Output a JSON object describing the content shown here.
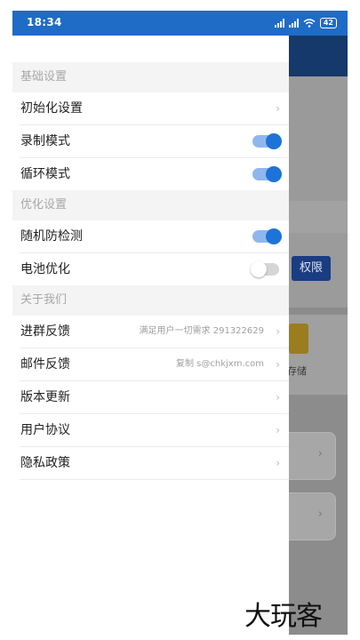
{
  "status_bar": {
    "time": "18:34",
    "battery": "42",
    "icons": [
      "signal-icon",
      "signal-icon",
      "wifi-icon",
      "battery-icon"
    ]
  },
  "background_app": {
    "permission_button": "权限",
    "storage_label": "存储"
  },
  "drawer": {
    "sections": [
      {
        "title": "基础设置",
        "items": [
          {
            "label": "初始化设置",
            "type": "chevron"
          },
          {
            "label": "录制模式",
            "type": "toggle",
            "on": true
          },
          {
            "label": "循环模式",
            "type": "toggle",
            "on": true
          }
        ]
      },
      {
        "title": "优化设置",
        "items": [
          {
            "label": "随机防检测",
            "type": "toggle",
            "on": true
          },
          {
            "label": "电池优化",
            "type": "toggle",
            "on": false
          }
        ]
      },
      {
        "title": "关于我们",
        "items": [
          {
            "label": "进群反馈",
            "sub": "满足用户一切需求 291322629",
            "type": "chevron"
          },
          {
            "label": "邮件反馈",
            "sub": "复制 s@chkjxm.com",
            "type": "chevron"
          },
          {
            "label": "版本更新",
            "type": "chevron"
          },
          {
            "label": "用户协议",
            "type": "chevron"
          },
          {
            "label": "隐私政策",
            "type": "chevron"
          }
        ]
      }
    ]
  },
  "watermark": "大玩客",
  "colors": {
    "status_bar": "#1e6cc6",
    "toggle_on": "#1e73d8",
    "section_bg": "#f4f4f4",
    "header_bg": "#15396b"
  }
}
